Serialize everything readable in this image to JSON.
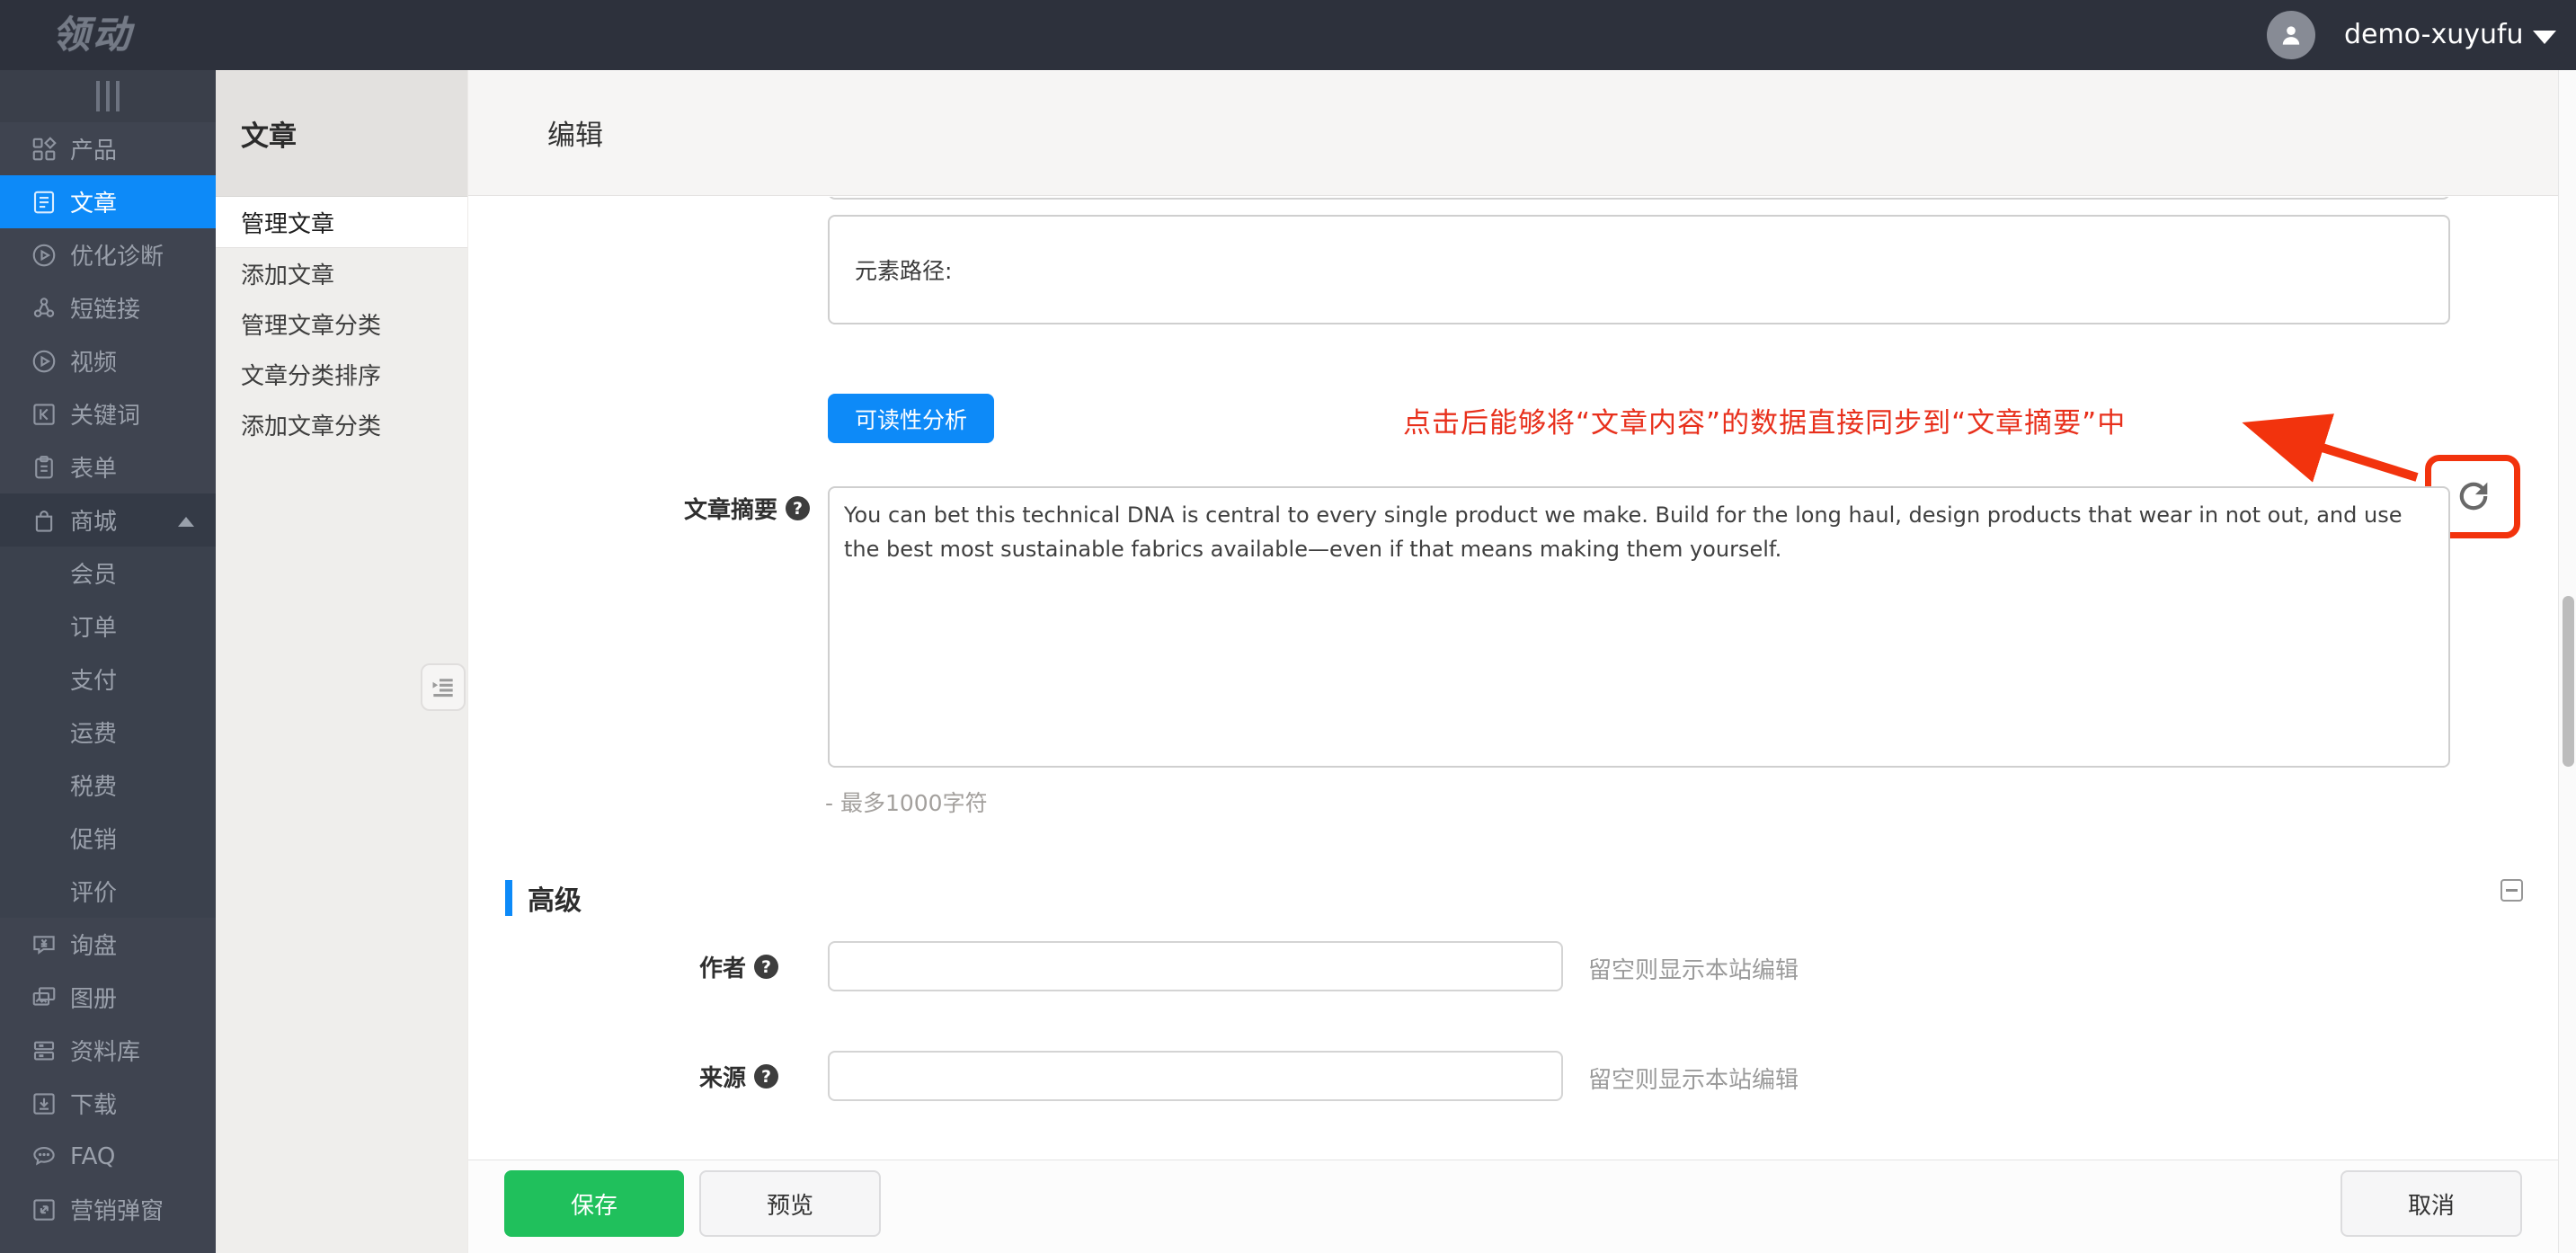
{
  "colors": {
    "accent_blue": "#0d8af8",
    "save_green": "#20c05c",
    "annotation_red": "#e8301c",
    "frame_red": "#f2330d"
  },
  "topbar": {
    "logo": "领动",
    "username": "demo-xuyufu"
  },
  "sidebar": {
    "items": [
      {
        "label": "产品",
        "icon": "products-grid-icon"
      },
      {
        "label": "文章",
        "icon": "article-icon",
        "active": true
      },
      {
        "label": "优化诊断",
        "icon": "diagnosis-play-icon"
      },
      {
        "label": "短链接",
        "icon": "shortlink-nodes-icon"
      },
      {
        "label": "视频",
        "icon": "video-play-icon"
      },
      {
        "label": "关键词",
        "icon": "keyword-k-icon"
      },
      {
        "label": "表单",
        "icon": "form-clipboard-icon"
      },
      {
        "label": "商城",
        "icon": "mall-bag-icon",
        "group": true,
        "expanded": true
      },
      {
        "label": "会员",
        "sub": true
      },
      {
        "label": "订单",
        "sub": true
      },
      {
        "label": "支付",
        "sub": true
      },
      {
        "label": "运费",
        "sub": true
      },
      {
        "label": "税费",
        "sub": true
      },
      {
        "label": "促销",
        "sub": true
      },
      {
        "label": "评价",
        "sub": true
      },
      {
        "label": "询盘",
        "icon": "inquiry-bubble-icon"
      },
      {
        "label": "图册",
        "icon": "gallery-image-icon"
      },
      {
        "label": "资料库",
        "icon": "library-stack-icon"
      },
      {
        "label": "下载",
        "icon": "download-icon"
      },
      {
        "label": "FAQ",
        "icon": "faq-bubble-icon"
      },
      {
        "label": "营销弹窗",
        "icon": "popup-expand-icon"
      }
    ]
  },
  "submenu": {
    "title": "文章",
    "items": [
      {
        "label": "管理文章",
        "active": true
      },
      {
        "label": "添加文章"
      },
      {
        "label": "管理文章分类"
      },
      {
        "label": "文章分类排序"
      },
      {
        "label": "添加文章分类"
      }
    ]
  },
  "main": {
    "title": "编辑",
    "element_path_label": "元素路径:",
    "readability_button": "可读性分析",
    "annotation_text": "点击后能够将“文章内容”的数据直接同步到“文章摘要”中",
    "summary_label": "文章摘要",
    "summary_value": "You can bet this technical DNA is central to every single product we make. Build for the long haul, design products that wear in not out, and use the best most sustainable fabrics available—even if that means making them yourself.",
    "summary_hint": "- 最多1000字符",
    "advanced_title": "高级",
    "author_label": "作者",
    "author_hint": "留空则显示本站编辑",
    "source_label": "来源",
    "source_hint": "留空则显示本站编辑",
    "save_button": "保存",
    "preview_button": "预览",
    "cancel_button": "取消"
  }
}
